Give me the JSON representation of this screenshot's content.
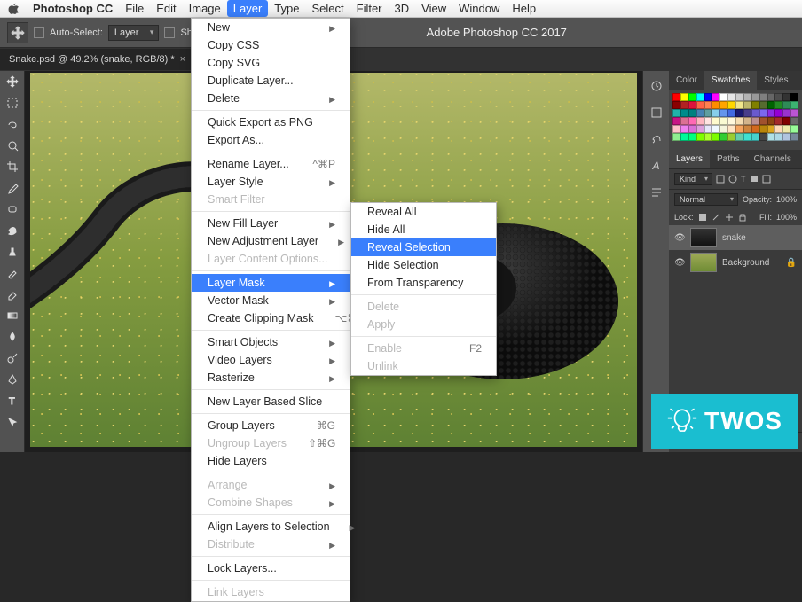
{
  "menubar": {
    "app": "Photoshop CC",
    "items": [
      "File",
      "Edit",
      "Image",
      "Layer",
      "Type",
      "Select",
      "Filter",
      "3D",
      "View",
      "Window",
      "Help"
    ],
    "active": "Layer"
  },
  "optbar": {
    "autoselect_label": "Auto-Select:",
    "autoselect_value": "Layer",
    "showtransform_label": "Show Transform",
    "app_title": "Adobe Photoshop CC 2017"
  },
  "doc_tab": {
    "label": "Snake.psd @ 49.2% (snake, RGB/8) *"
  },
  "layer_menu": [
    {
      "label": "New",
      "arrow": true
    },
    {
      "label": "Copy CSS"
    },
    {
      "label": "Copy SVG"
    },
    {
      "label": "Duplicate Layer..."
    },
    {
      "label": "Delete",
      "arrow": true
    },
    {
      "sep": true
    },
    {
      "label": "Quick Export as PNG"
    },
    {
      "label": "Export As..."
    },
    {
      "sep": true
    },
    {
      "label": "Rename Layer...",
      "shortcut": "^⌘P"
    },
    {
      "label": "Layer Style",
      "arrow": true
    },
    {
      "label": "Smart Filter",
      "disabled": true
    },
    {
      "sep": true
    },
    {
      "label": "New Fill Layer",
      "arrow": true
    },
    {
      "label": "New Adjustment Layer",
      "arrow": true
    },
    {
      "label": "Layer Content Options...",
      "disabled": true
    },
    {
      "sep": true
    },
    {
      "label": "Layer Mask",
      "arrow": true,
      "highlight": true
    },
    {
      "label": "Vector Mask",
      "arrow": true
    },
    {
      "label": "Create Clipping Mask",
      "shortcut": "⌥⌘G"
    },
    {
      "sep": true
    },
    {
      "label": "Smart Objects",
      "arrow": true
    },
    {
      "label": "Video Layers",
      "arrow": true
    },
    {
      "label": "Rasterize",
      "arrow": true
    },
    {
      "sep": true
    },
    {
      "label": "New Layer Based Slice"
    },
    {
      "sep": true
    },
    {
      "label": "Group Layers",
      "shortcut": "⌘G"
    },
    {
      "label": "Ungroup Layers",
      "shortcut": "⇧⌘G",
      "disabled": true
    },
    {
      "label": "Hide Layers"
    },
    {
      "sep": true
    },
    {
      "label": "Arrange",
      "arrow": true,
      "disabled": true
    },
    {
      "label": "Combine Shapes",
      "arrow": true,
      "disabled": true
    },
    {
      "sep": true
    },
    {
      "label": "Align Layers to Selection",
      "arrow": true
    },
    {
      "label": "Distribute",
      "arrow": true,
      "disabled": true
    },
    {
      "sep": true
    },
    {
      "label": "Lock Layers..."
    },
    {
      "sep": true
    },
    {
      "label": "Link Layers",
      "disabled": true
    }
  ],
  "submenu": [
    {
      "label": "Reveal All"
    },
    {
      "label": "Hide All"
    },
    {
      "label": "Reveal Selection",
      "highlight": true
    },
    {
      "label": "Hide Selection"
    },
    {
      "label": "From Transparency"
    },
    {
      "sep": true
    },
    {
      "label": "Delete",
      "disabled": true
    },
    {
      "label": "Apply",
      "disabled": true
    },
    {
      "sep": true
    },
    {
      "label": "Enable",
      "disabled": true,
      "shortcut": "F2"
    },
    {
      "label": "Unlink",
      "disabled": true
    }
  ],
  "swatch_tab": {
    "tabs": [
      "Color",
      "Swatches",
      "Styles"
    ],
    "active": "Swatches"
  },
  "swatch_colors": [
    "#ff0000",
    "#ffff00",
    "#00ff00",
    "#00ffff",
    "#0000ff",
    "#ff00ff",
    "#ffffff",
    "#e5e5e5",
    "#cccccc",
    "#b3b3b3",
    "#999999",
    "#808080",
    "#666666",
    "#4d4d4d",
    "#333333",
    "#000000",
    "#8b0000",
    "#b22222",
    "#dc143c",
    "#ff6347",
    "#ff7f50",
    "#ff8c00",
    "#ffa500",
    "#ffd700",
    "#f0e68c",
    "#bdb76b",
    "#808000",
    "#556b2f",
    "#006400",
    "#228b22",
    "#2e8b57",
    "#3cb371",
    "#20b2aa",
    "#008b8b",
    "#008080",
    "#4682b4",
    "#5f9ea0",
    "#87ceeb",
    "#6495ed",
    "#4169e1",
    "#191970",
    "#483d8b",
    "#6a5acd",
    "#7b68ee",
    "#8a2be2",
    "#9400d3",
    "#9932cc",
    "#ba55d3",
    "#c71585",
    "#db7093",
    "#ff69b4",
    "#ffb6c1",
    "#ffe4e1",
    "#fffacd",
    "#fafad2",
    "#fff8dc",
    "#f5deb3",
    "#d2b48c",
    "#bc8f8f",
    "#a0522d",
    "#8b4513",
    "#a52a2a",
    "#800000",
    "#696969",
    "#ffc0cb",
    "#ee82ee",
    "#da70d6",
    "#dda0dd",
    "#e6e6fa",
    "#f0f8ff",
    "#f5f5dc",
    "#ffe4c4",
    "#f4a460",
    "#cd853f",
    "#d2691e",
    "#b8860b",
    "#daa520",
    "#ffdab9",
    "#eee8aa",
    "#98fb98",
    "#90ee90",
    "#00fa9a",
    "#00ff7f",
    "#7fff00",
    "#adff2f",
    "#7cfc00",
    "#32cd32",
    "#9acd32",
    "#66cdaa",
    "#40e0d0",
    "#48d1cc",
    "#afeee",
    "#b0e0e6",
    "#add8e6",
    "#b0c4de",
    "#778899"
  ],
  "layers_panel": {
    "tabs": [
      "Layers",
      "Paths",
      "Channels"
    ],
    "active": "Layers",
    "kind_label": "Kind",
    "blend": "Normal",
    "opacity_label": "Opacity:",
    "opacity_value": "100%",
    "lock_label": "Lock:",
    "fill_label": "Fill:",
    "fill_value": "100%",
    "rows": [
      {
        "name": "snake",
        "selected": true
      },
      {
        "name": "Background",
        "locked": true
      }
    ]
  },
  "logo": {
    "text": "TWOS"
  }
}
